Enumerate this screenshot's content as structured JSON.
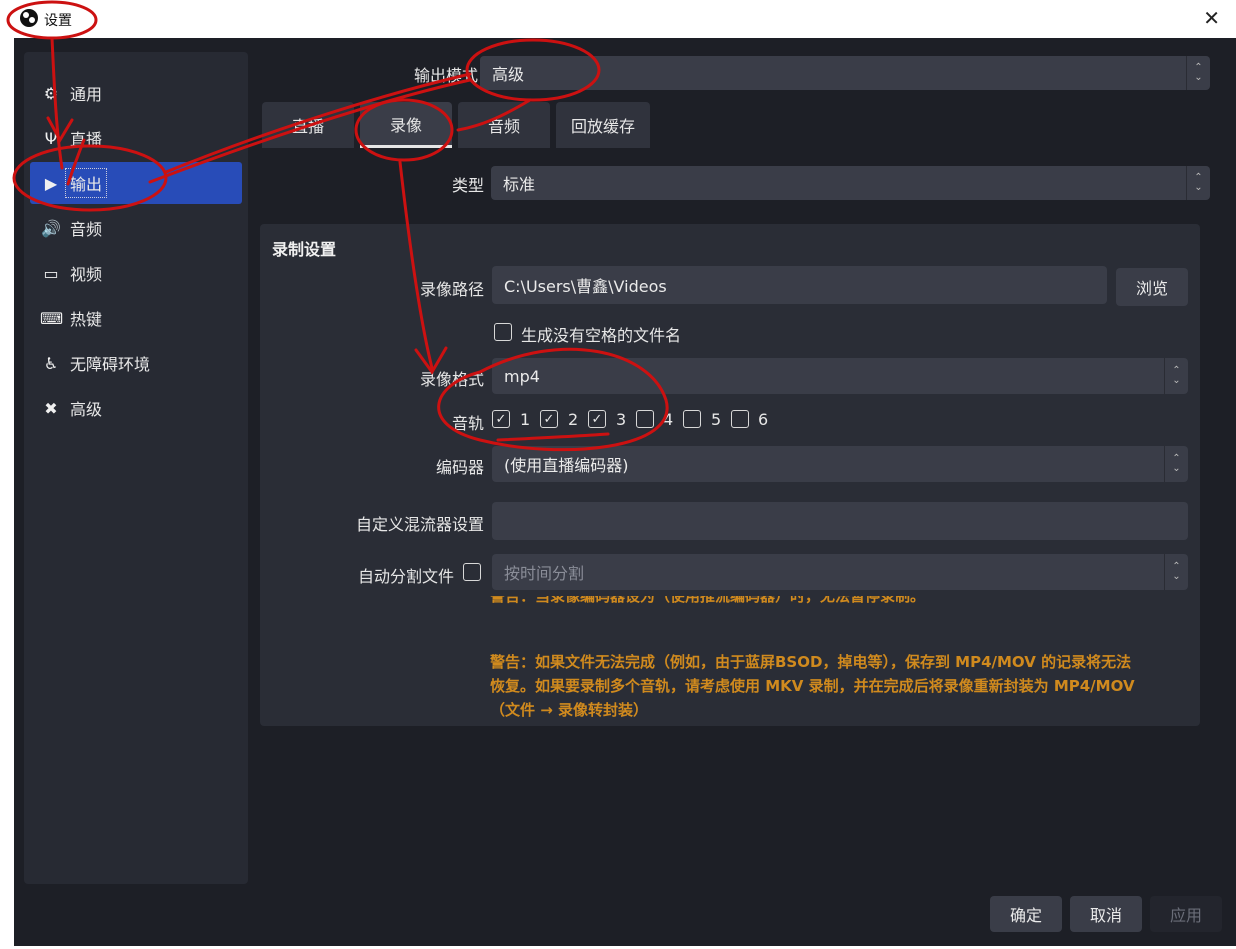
{
  "window": {
    "title": "设置"
  },
  "sidebar": {
    "items": [
      {
        "label": "通用",
        "icon": "gear-icon",
        "glyph": "⚙"
      },
      {
        "label": "直播",
        "icon": "antenna-icon",
        "glyph": "Ψ"
      },
      {
        "label": "输出",
        "icon": "output-icon",
        "glyph": "▶"
      },
      {
        "label": "音频",
        "icon": "speaker-icon",
        "glyph": "🔊"
      },
      {
        "label": "视频",
        "icon": "monitor-icon",
        "glyph": "▭"
      },
      {
        "label": "热键",
        "icon": "keyboard-icon",
        "glyph": "⌨"
      },
      {
        "label": "无障碍环境",
        "icon": "accessibility-icon",
        "glyph": "♿"
      },
      {
        "label": "高级",
        "icon": "tools-icon",
        "glyph": "✖"
      }
    ],
    "active_index": 2
  },
  "output_mode": {
    "label": "输出模式",
    "value": "高级"
  },
  "tabs": [
    "直播",
    "录像",
    "音频",
    "回放缓存"
  ],
  "active_tab": 1,
  "type": {
    "label": "类型",
    "value": "标准"
  },
  "recording": {
    "group_title": "录制设置",
    "path_label": "录像路径",
    "path_value": "C:\\Users\\曹鑫\\Videos",
    "browse_label": "浏览",
    "no_space_label": "生成没有空格的文件名",
    "no_space_checked": false,
    "format_label": "录像格式",
    "format_value": "mp4",
    "tracks_label": "音轨",
    "tracks": [
      {
        "label": "1",
        "checked": true
      },
      {
        "label": "2",
        "checked": true
      },
      {
        "label": "3",
        "checked": true
      },
      {
        "label": "4",
        "checked": false
      },
      {
        "label": "5",
        "checked": false
      },
      {
        "label": "6",
        "checked": false
      }
    ],
    "encoder_label": "编码器",
    "encoder_value": "(使用直播编码器)",
    "muxer_label": "自定义混流器设置",
    "muxer_value": "",
    "split_label": "自动分割文件",
    "split_checked": false,
    "split_placeholder": "按时间分割",
    "warning_1": "警告：当录像编码器设为（使用推流编码器）时，无法暂停录制。",
    "warning_2_line1": "警告：如果文件无法完成（例如，由于蓝屏BSOD，掉电等），保存到 MP4/MOV 的记录将无法",
    "warning_2_line2": "恢复。如果要录制多个音轨，请考虑使用 MKV 录制，并在完成后将录像重新封装为 MP4/MOV",
    "warning_2_line3": "（文件 → 录像转封装）"
  },
  "footer": {
    "ok": "确定",
    "cancel": "取消",
    "apply": "应用"
  },
  "colors": {
    "accent": "#284cb8",
    "warning": "#d08a1e",
    "annotation": "#cc1111"
  }
}
